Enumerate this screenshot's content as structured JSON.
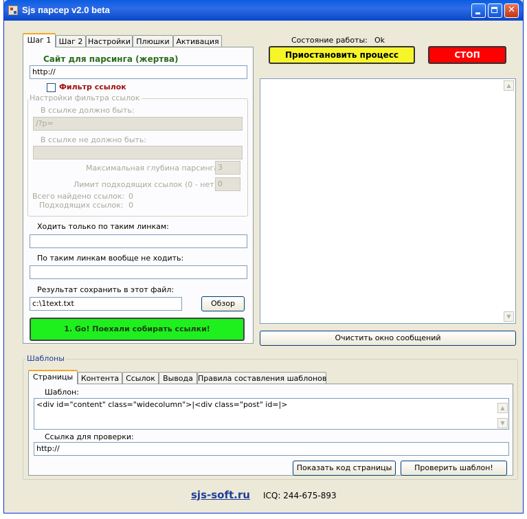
{
  "window": {
    "title": "Sjs парсер v2.0 beta"
  },
  "step_tabs": [
    "Шаг 1",
    "Шаг 2",
    "Настройки",
    "Плюшки",
    "Активация"
  ],
  "step1": {
    "site_label": "Сайт для парсинга (жертва)",
    "site_value": "http://",
    "filter_checkbox_label": "Фильтр ссылок",
    "filter_group_title": "Настройки фильтра ссылок",
    "must_contain_label": "В ссылке должно быть:",
    "must_contain_value": "/?p=",
    "must_not_contain_label": "В ссылке не должно быть:",
    "must_not_contain_value": "",
    "max_depth_label": "Максимальная глубина парсинга:",
    "max_depth_value": "3",
    "limit_label": "Лимит подходящих ссылок (0 - нет):",
    "limit_value": "0",
    "total_found_label": "Всего найдено ссылок:",
    "total_found_value": "0",
    "matching_label": "Подходящих ссылок:",
    "matching_value": "0",
    "only_links_label": "Ходить только по таким линкам:",
    "only_links_value": "",
    "never_links_label": "По таким линкам вообще не ходить:",
    "never_links_value": "",
    "save_file_label": "Результат сохранить в этот файл:",
    "save_file_value": "c:\\1text.txt",
    "browse_button": "Обзор",
    "go_button": "1. Go! Поехали собирать ссылки!"
  },
  "status": {
    "label": "Состояние работы:",
    "value": "Ok"
  },
  "pause_button": "Приостановить процесс",
  "stop_button": "стоп",
  "clear_log_button": "Очистить окно сообщений",
  "templates": {
    "group_title": "Шаблоны",
    "tabs": [
      "Страницы",
      "Контента",
      "Ссылок",
      "Вывода",
      "Правила составления шаблонов"
    ],
    "template_label": "Шаблон:",
    "template_value": "<div id=\"content\" class=\"widecolumn\">|<div class=\"post\" id=|>",
    "check_link_label": "Ссылка для проверки:",
    "check_link_value": "http://",
    "show_code_button": "Показать код страницы",
    "check_template_button": "Проверить шаблон!"
  },
  "footer": {
    "site": "sjs-soft.ru",
    "icq": "ICQ: 244-675-893"
  },
  "colors": {
    "go_button": "#1ef01e",
    "pause_button": "#f5f52a",
    "stop_button": "#ff0000",
    "title_green": "#2a6e1c",
    "filter_red": "#a01010"
  }
}
